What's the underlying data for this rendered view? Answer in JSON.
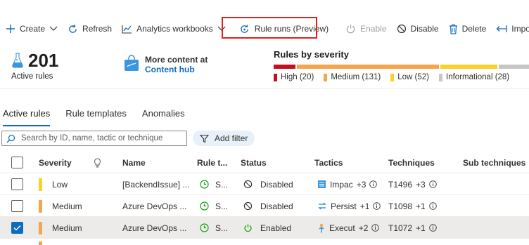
{
  "toolbar": {
    "create": "Create",
    "refresh": "Refresh",
    "analytics": "Analytics workbooks",
    "rule_runs": "Rule runs (Preview)",
    "enable": "Enable",
    "disable": "Disable",
    "delete": "Delete",
    "import": "Import"
  },
  "summary": {
    "active_count": "201",
    "active_label": "Active rules",
    "hub_line1": "More content at",
    "hub_line2": "Content hub",
    "severity_title": "Rules by severity",
    "severity": [
      {
        "label": "High (20)",
        "value": 20,
        "color": "#c50f1f"
      },
      {
        "label": "Medium (131)",
        "value": 131,
        "color": "#f7a54a"
      },
      {
        "label": "Low (52)",
        "value": 52,
        "color": "#f8d22a"
      },
      {
        "label": "Informational (28)",
        "value": 28,
        "color": "#c8c6c4"
      }
    ]
  },
  "tabs": [
    "Active rules",
    "Rule templates",
    "Anomalies"
  ],
  "search": {
    "placeholder": "Search by ID, name, tactic or technique"
  },
  "filter": {
    "label": "Add filter"
  },
  "table": {
    "headers": {
      "severity": "Severity",
      "name": "Name",
      "rule_type": "Rule t...",
      "status": "Status",
      "tactics": "Tactics",
      "techniques": "Techniques",
      "sub_techniques": "Sub techniques"
    },
    "rows": [
      {
        "severity": "Low",
        "severity_color": "#f8d22a",
        "name": "[BackendIssue] ...",
        "rule_type": "S...",
        "status": "Disabled",
        "tactic": "Impac",
        "tactic_more": "+3",
        "technique": "T1496",
        "technique_more": "+3",
        "selected": false
      },
      {
        "severity": "Medium",
        "severity_color": "#f7a54a",
        "name": "Azure DevOps ...",
        "rule_type": "S...",
        "status": "Disabled",
        "tactic": "Persist",
        "tactic_more": "+1",
        "technique": "T1098",
        "technique_more": "+1",
        "selected": false
      },
      {
        "severity": "Medium",
        "severity_color": "#f7a54a",
        "name": "Azure DevOps ...",
        "rule_type": "S...",
        "status": "Enabled",
        "tactic": "Execut",
        "tactic_more": "+2",
        "technique": "T1072",
        "technique_more": "+1",
        "selected": true
      }
    ]
  }
}
